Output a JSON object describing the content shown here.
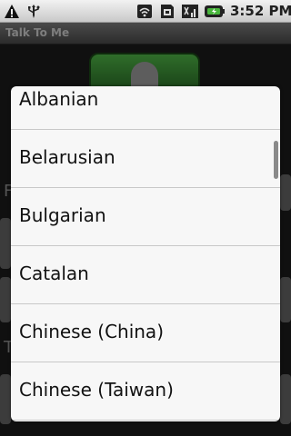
{
  "status_bar": {
    "time": "3:52 PM",
    "icons": [
      "warning-icon",
      "usb-icon",
      "wifi-icon",
      "sim-icon",
      "signal-icon",
      "battery-icon"
    ]
  },
  "app": {
    "title": "Talk To Me",
    "background_labels": [
      "F",
      "T"
    ]
  },
  "language_list": {
    "items": [
      "Albanian",
      "Belarusian",
      "Bulgarian",
      "Catalan",
      "Chinese (China)",
      "Chinese (Taiwan)"
    ]
  },
  "colors": {
    "status_bar": "#d8d8d8",
    "title_bar": "#3a3a3a",
    "dialog_bg": "#f7f7f7",
    "mic_button": "#2f6d2a"
  }
}
